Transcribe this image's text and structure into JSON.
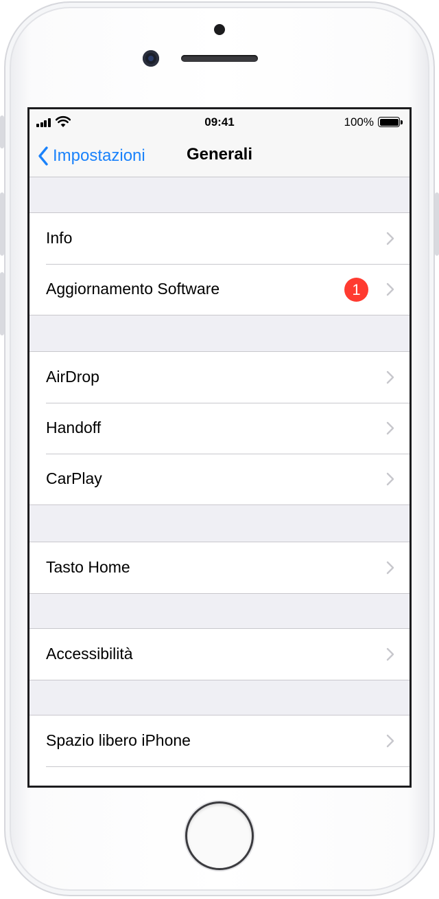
{
  "status_bar": {
    "time": "09:41",
    "battery": "100%"
  },
  "nav": {
    "back_label": "Impostazioni",
    "title": "Generali"
  },
  "groups": [
    {
      "rows": [
        {
          "label": "Info"
        },
        {
          "label": "Aggiornamento Software",
          "badge": "1"
        }
      ]
    },
    {
      "rows": [
        {
          "label": "AirDrop"
        },
        {
          "label": "Handoff"
        },
        {
          "label": "CarPlay"
        }
      ]
    },
    {
      "rows": [
        {
          "label": "Tasto Home"
        }
      ]
    },
    {
      "rows": [
        {
          "label": "Accessibilità"
        }
      ]
    },
    {
      "rows": [
        {
          "label": "Spazio libero iPhone"
        }
      ]
    }
  ],
  "colors": {
    "accent": "#1a82fb",
    "badge": "#ff3b30",
    "background": "#efeff4",
    "separator": "#c8c7cc"
  },
  "icons": [
    "back-chevron-icon",
    "chevron-right-icon",
    "signal-icon",
    "wifi-icon",
    "battery-icon"
  ]
}
